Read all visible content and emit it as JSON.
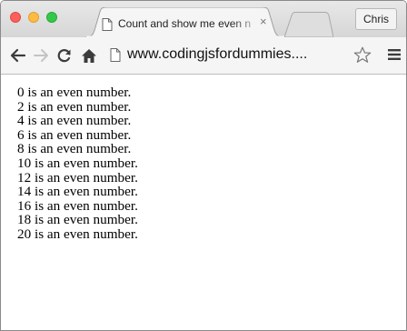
{
  "tab": {
    "title": "Count and show me even n",
    "close_glyph": "×"
  },
  "profile": {
    "name": "Chris"
  },
  "toolbar": {
    "url": "www.codingjsfordummies....",
    "icons": [
      "back-arrow-icon",
      "forward-arrow-icon",
      "reload-icon",
      "home-icon",
      "page-icon",
      "star-icon",
      "menu-icon"
    ]
  },
  "content": {
    "lines": [
      "0 is an even number.",
      "2 is an even number.",
      "4 is an even number.",
      "6 is an even number.",
      "8 is an even number.",
      "10 is an even number.",
      "12 is an even number.",
      "14 is an even number.",
      "16 is an even number.",
      "18 is an even number.",
      "20 is an even number."
    ]
  },
  "colors": {
    "close_red": "#fc605c",
    "minimize_yellow": "#fdbc40",
    "zoom_green": "#34c84a"
  }
}
